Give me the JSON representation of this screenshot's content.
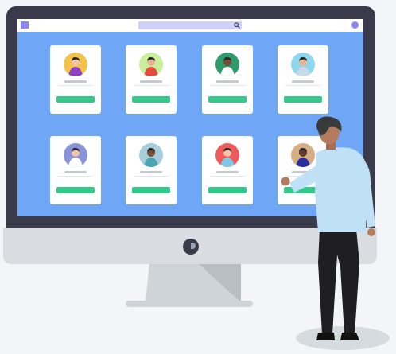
{
  "colors": {
    "screen": "#6fa6f5",
    "frame": "#3b3a4a",
    "button": "#34c98a",
    "accent": "#8b86f3"
  },
  "browser": {
    "search_icon": "magnifier-icon"
  },
  "profiles": [
    {
      "avatar_bg": "#f2c24b",
      "shirt": "#8e3fc2",
      "skin": "#f1c3a7"
    },
    {
      "avatar_bg": "#c9ef9a",
      "shirt": "#e34b3c",
      "skin": "#e7b393"
    },
    {
      "avatar_bg": "#2f9a6b",
      "shirt": "#ffffff",
      "skin": "#7a4b33"
    },
    {
      "avatar_bg": "#8fd7ec",
      "shirt": "#c9d9e8",
      "skin": "#e7b393"
    },
    {
      "avatar_bg": "#8a92d9",
      "shirt": "#ffffff",
      "skin": "#f1c3a7"
    },
    {
      "avatar_bg": "#a5ceda",
      "shirt": "#4da3b4",
      "skin": "#7a4b33"
    },
    {
      "avatar_bg": "#f05a5a",
      "shirt": "#7fc9e6",
      "skin": "#f1c3a7"
    },
    {
      "avatar_bg": "#d7ad86",
      "shirt": "#2a2f9f",
      "skin": "#5f3a2a"
    }
  ]
}
